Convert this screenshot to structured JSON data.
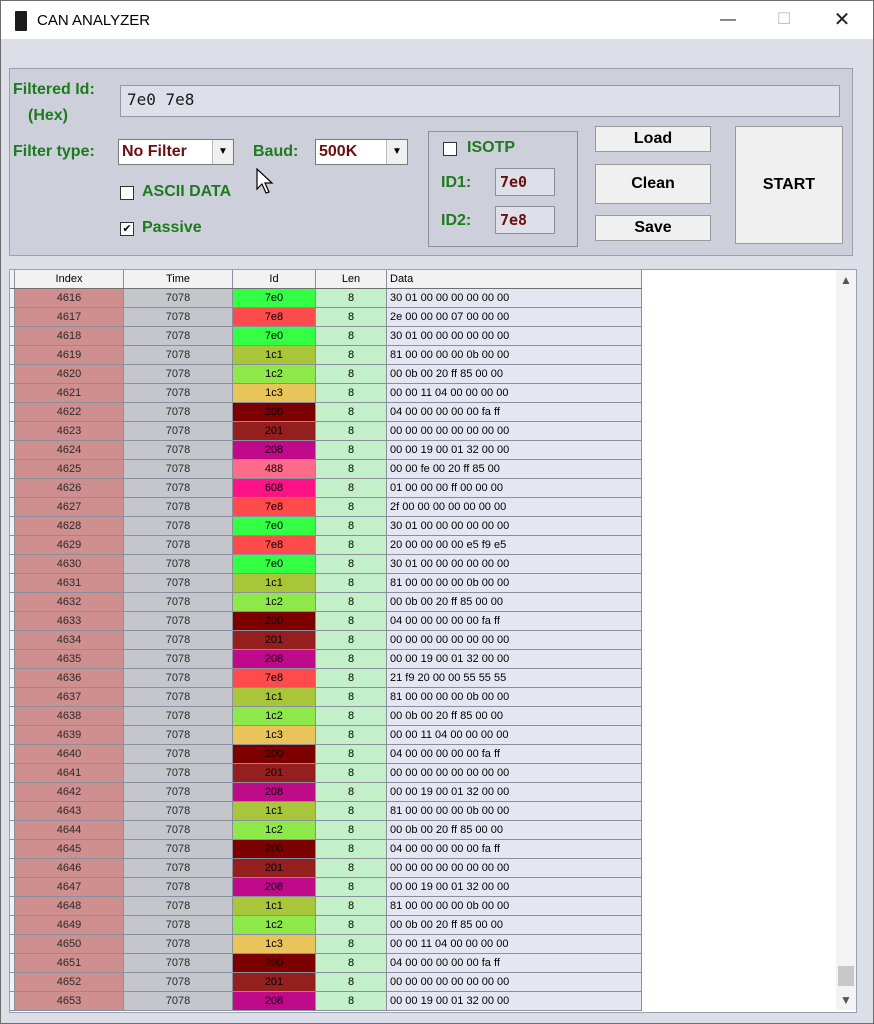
{
  "window": {
    "title": "CAN ANALYZER",
    "minimize_label": "—",
    "maximize_label": "☐",
    "close_label": "✕"
  },
  "filter": {
    "filtered_id_label": "Filtered Id:",
    "hex_label": "(Hex)",
    "filtered_id_value": "7e0 7e8",
    "filter_type_label": "Filter type:",
    "filter_type_value": "No Filter",
    "baud_label": "Baud:",
    "baud_value": "500K",
    "ascii_label": "ASCII DATA",
    "ascii_checked": false,
    "passive_label": "Passive",
    "passive_checked": true
  },
  "isotp": {
    "label": "ISOTP",
    "checked": false,
    "id1_label": "ID1:",
    "id1_value": "7e0",
    "id2_label": "ID2:",
    "id2_value": "7e8"
  },
  "buttons": {
    "load": "Load",
    "clean": "Clean",
    "save": "Save",
    "start": "START"
  },
  "grid": {
    "columns": [
      "Index",
      "Time",
      "Id",
      "Len",
      "Data"
    ],
    "rows": [
      {
        "index": "4616",
        "time": "7078",
        "id": "7e0",
        "len": "8",
        "data": "30 01 00 00 00 00 00 00"
      },
      {
        "index": "4617",
        "time": "7078",
        "id": "7e8",
        "len": "8",
        "data": "2e 00 00 00 07 00 00 00"
      },
      {
        "index": "4618",
        "time": "7078",
        "id": "7e0",
        "len": "8",
        "data": "30 01 00 00 00 00 00 00"
      },
      {
        "index": "4619",
        "time": "7078",
        "id": "1c1",
        "len": "8",
        "data": "81 00 00 00 00 0b 00 00"
      },
      {
        "index": "4620",
        "time": "7078",
        "id": "1c2",
        "len": "8",
        "data": "00 0b 00 20 ff 85 00 00"
      },
      {
        "index": "4621",
        "time": "7078",
        "id": "1c3",
        "len": "8",
        "data": "00 00 11 04 00 00 00 00"
      },
      {
        "index": "4622",
        "time": "7078",
        "id": "200",
        "len": "8",
        "data": "04 00 00 00 00 00 fa ff"
      },
      {
        "index": "4623",
        "time": "7078",
        "id": "201",
        "len": "8",
        "data": "00 00 00 00 00 00 00 00"
      },
      {
        "index": "4624",
        "time": "7078",
        "id": "208",
        "len": "8",
        "data": "00 00 19 00 01 32 00 00"
      },
      {
        "index": "4625",
        "time": "7078",
        "id": "488",
        "len": "8",
        "data": "00 00 fe 00 20 ff 85 00"
      },
      {
        "index": "4626",
        "time": "7078",
        "id": "608",
        "len": "8",
        "data": "01 00 00 00 ff 00 00 00"
      },
      {
        "index": "4627",
        "time": "7078",
        "id": "7e8",
        "len": "8",
        "data": "2f 00 00 00 00 00 00 00"
      },
      {
        "index": "4628",
        "time": "7078",
        "id": "7e0",
        "len": "8",
        "data": "30 01 00 00 00 00 00 00"
      },
      {
        "index": "4629",
        "time": "7078",
        "id": "7e8",
        "len": "8",
        "data": "20 00 00 00 00 e5 f9 e5"
      },
      {
        "index": "4630",
        "time": "7078",
        "id": "7e0",
        "len": "8",
        "data": "30 01 00 00 00 00 00 00"
      },
      {
        "index": "4631",
        "time": "7078",
        "id": "1c1",
        "len": "8",
        "data": "81 00 00 00 00 0b 00 00"
      },
      {
        "index": "4632",
        "time": "7078",
        "id": "1c2",
        "len": "8",
        "data": "00 0b 00 20 ff 85 00 00"
      },
      {
        "index": "4633",
        "time": "7078",
        "id": "200",
        "len": "8",
        "data": "04 00 00 00 00 00 fa ff"
      },
      {
        "index": "4634",
        "time": "7078",
        "id": "201",
        "len": "8",
        "data": "00 00 00 00 00 00 00 00"
      },
      {
        "index": "4635",
        "time": "7078",
        "id": "208",
        "len": "8",
        "data": "00 00 19 00 01 32 00 00"
      },
      {
        "index": "4636",
        "time": "7078",
        "id": "7e8",
        "len": "8",
        "data": "21 f9 20 00 00 55 55 55"
      },
      {
        "index": "4637",
        "time": "7078",
        "id": "1c1",
        "len": "8",
        "data": "81 00 00 00 00 0b 00 00"
      },
      {
        "index": "4638",
        "time": "7078",
        "id": "1c2",
        "len": "8",
        "data": "00 0b 00 20 ff 85 00 00"
      },
      {
        "index": "4639",
        "time": "7078",
        "id": "1c3",
        "len": "8",
        "data": "00 00 11 04 00 00 00 00"
      },
      {
        "index": "4640",
        "time": "7078",
        "id": "200",
        "len": "8",
        "data": "04 00 00 00 00 00 fa ff"
      },
      {
        "index": "4641",
        "time": "7078",
        "id": "201",
        "len": "8",
        "data": "00 00 00 00 00 00 00 00"
      },
      {
        "index": "4642",
        "time": "7078",
        "id": "208",
        "len": "8",
        "data": "00 00 19 00 01 32 00 00"
      },
      {
        "index": "4643",
        "time": "7078",
        "id": "1c1",
        "len": "8",
        "data": "81 00 00 00 00 0b 00 00"
      },
      {
        "index": "4644",
        "time": "7078",
        "id": "1c2",
        "len": "8",
        "data": "00 0b 00 20 ff 85 00 00"
      },
      {
        "index": "4645",
        "time": "7078",
        "id": "200",
        "len": "8",
        "data": "04 00 00 00 00 00 fa ff"
      },
      {
        "index": "4646",
        "time": "7078",
        "id": "201",
        "len": "8",
        "data": "00 00 00 00 00 00 00 00"
      },
      {
        "index": "4647",
        "time": "7078",
        "id": "208",
        "len": "8",
        "data": "00 00 19 00 01 32 00 00"
      },
      {
        "index": "4648",
        "time": "7078",
        "id": "1c1",
        "len": "8",
        "data": "81 00 00 00 00 0b 00 00"
      },
      {
        "index": "4649",
        "time": "7078",
        "id": "1c2",
        "len": "8",
        "data": "00 0b 00 20 ff 85 00 00"
      },
      {
        "index": "4650",
        "time": "7078",
        "id": "1c3",
        "len": "8",
        "data": "00 00 11 04 00 00 00 00"
      },
      {
        "index": "4651",
        "time": "7078",
        "id": "200",
        "len": "8",
        "data": "04 00 00 00 00 00 fa ff"
      },
      {
        "index": "4652",
        "time": "7078",
        "id": "201",
        "len": "8",
        "data": "00 00 00 00 00 00 00 00"
      },
      {
        "index": "4653",
        "time": "7078",
        "id": "208",
        "len": "8",
        "data": "00 00 19 00 01 32 00 00"
      }
    ],
    "id_colors": {
      "7e0": "#33ff44",
      "7e8": "#ff4b4b",
      "1c1": "#a9c63a",
      "1c2": "#8fe84a",
      "1c3": "#e8c45a",
      "200": "#7d0000",
      "201": "#951f1f",
      "208": "#bf0a8a",
      "488": "#ff6b8a",
      "608": "#ff1188"
    }
  }
}
